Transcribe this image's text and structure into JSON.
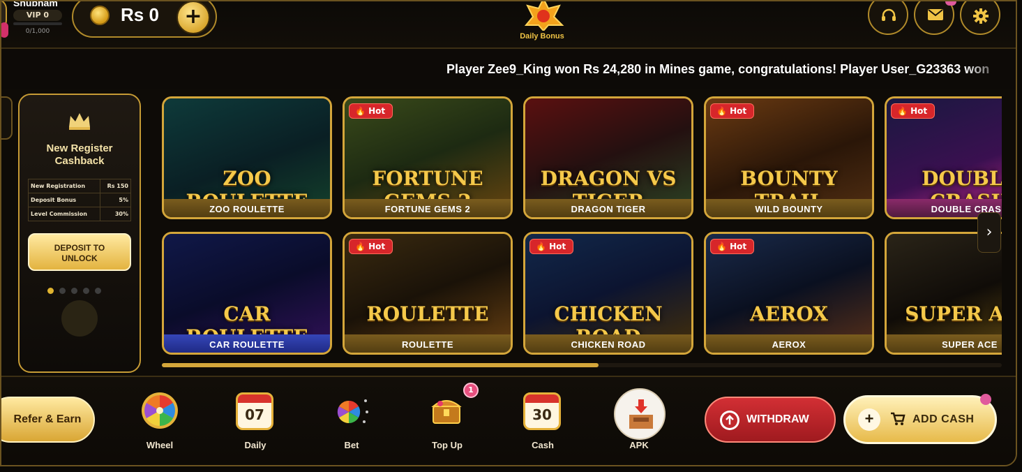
{
  "header": {
    "username": "Shubham",
    "vip_level": "VIP 0",
    "vip_progress": "0/1,000",
    "balance": "Rs 0",
    "add_label": "+",
    "daily_bonus_label": "Daily Bonus",
    "buttons": [
      "headset-icon",
      "mail-icon",
      "gear-icon"
    ]
  },
  "ticker": {
    "text": "Player Zee9_King won Rs 24,280 in Mines game, congratulations! Player User_G23363 won"
  },
  "promo": {
    "title_line1": "New Register",
    "title_line2": "Cashback",
    "rows": [
      {
        "label": "New Registration",
        "value": "Rs 150"
      },
      {
        "label": "Deposit Bonus",
        "value": "5%"
      },
      {
        "label": "Level Commission",
        "value": "30%"
      }
    ],
    "button_line1": "DEPOSIT TO",
    "button_line2": "UNLOCK",
    "active_dot": 0,
    "dot_count": 5
  },
  "games": [
    {
      "name": "ZOO ROULETTE",
      "art_title": "ZOO ROULETTE",
      "hot": false
    },
    {
      "name": "FORTUNE GEMS 2",
      "art_title": "FORTUNE GEMS 2",
      "hot": true
    },
    {
      "name": "DRAGON TIGER",
      "art_title": "DRAGON VS TIGER",
      "hot": false
    },
    {
      "name": "WILD BOUNTY",
      "art_title": "BOUNTY TRAIL",
      "hot": true
    },
    {
      "name": "DOUBLE CRASH",
      "art_title": "DOUBLE CRASH",
      "hot": true
    },
    {
      "name": "CAR ROULETTE",
      "art_title": "CAR ROULETTE",
      "hot": false
    },
    {
      "name": "ROULETTE",
      "art_title": "ROULETTE",
      "hot": true
    },
    {
      "name": "CHICKEN ROAD",
      "art_title": "CHICKEN ROAD",
      "hot": true
    },
    {
      "name": "AEROX",
      "art_title": "AEROX",
      "hot": true
    },
    {
      "name": "SUPER ACE",
      "art_title": "SUPER ACE",
      "hot": false
    }
  ],
  "hot_label": "Hot",
  "scroll_progress": 0.52,
  "bottom": {
    "refer_label": "Refer & Earn",
    "nav": [
      {
        "label": "Wheel",
        "icon": "wheel-icon"
      },
      {
        "label": "Daily",
        "icon": "calendar-icon",
        "value": "07"
      },
      {
        "label": "Bet",
        "icon": "bet-wheel-icon"
      },
      {
        "label": "Top Up",
        "icon": "treasure-chest-icon",
        "badge": "1"
      },
      {
        "label": "Cash",
        "icon": "calendar-icon",
        "value": "30"
      },
      {
        "label": "APK",
        "icon": "download-box-icon"
      }
    ],
    "withdraw_label": "WITHDRAW",
    "add_cash_label": "ADD CASH"
  },
  "colors": {
    "gold": "#d4a63a",
    "hot_red": "#d7262a",
    "withdraw_red": "#c0282d",
    "background": "#0e0b07"
  }
}
